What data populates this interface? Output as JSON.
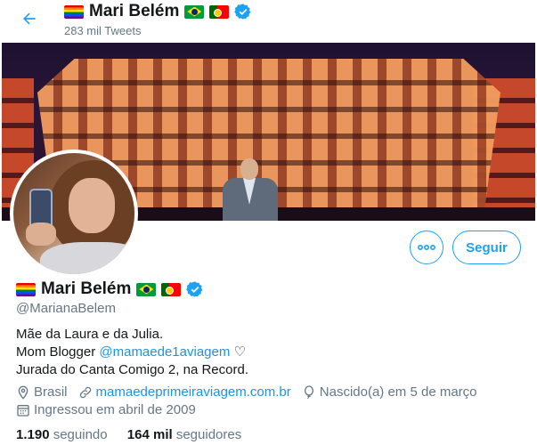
{
  "header": {
    "name": "Mari Belém",
    "tweet_count": "283 mil Tweets"
  },
  "profile": {
    "name": "Mari Belém",
    "handle": "@MarianaBelem",
    "bio_line1": "Mãe da Laura e da Julia.",
    "bio_line2_prefix": "Mom Blogger ",
    "bio_mention": "@mamaede1aviagem",
    "bio_line2_suffix": " ♡",
    "bio_line3": "Jurada do Canta Comigo 2, na Record.",
    "location": "Brasil",
    "website": "mamaedeprimeiraviagem.com.br",
    "birthday": "Nascido(a) em 5 de março",
    "joined": "Ingressou em abril de 2009",
    "following_count": "1.190",
    "following_label": "seguindo",
    "followers_count": "164 mil",
    "followers_label": "seguidores"
  },
  "buttons": {
    "follow_label": "Seguir"
  },
  "icons": {
    "back": "arrow-left-icon",
    "more": "more-dots-icon",
    "verified": "verified-badge-icon",
    "location": "location-pin-icon",
    "link": "link-icon",
    "birthday": "balloon-icon",
    "joined": "calendar-icon"
  },
  "colors": {
    "accent": "#1da1f2",
    "link": "#1b95e0",
    "secondary_text": "#657786"
  }
}
